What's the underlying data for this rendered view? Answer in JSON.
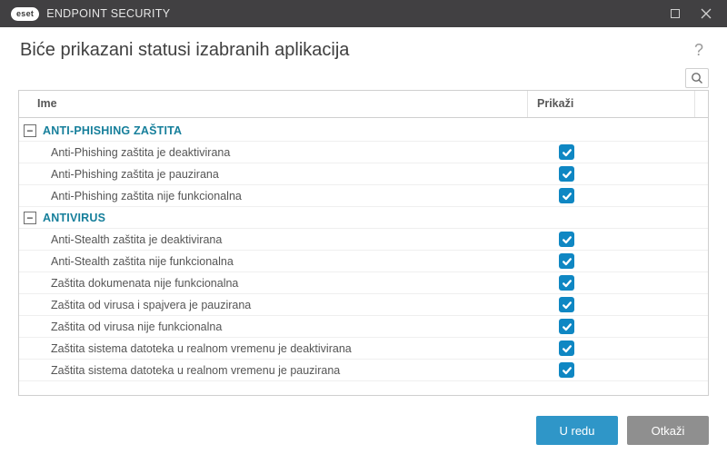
{
  "titlebar": {
    "brand_badge": "eset",
    "product": "ENDPOINT SECURITY"
  },
  "header": {
    "title": "Biće prikazani statusi izabranih aplikacija",
    "help_symbol": "?"
  },
  "columns": {
    "name": "Ime",
    "show": "Prikaži"
  },
  "toggle_glyph": "−",
  "groups": [
    {
      "label": "ANTI-PHISHING ZAŠTITA",
      "items": [
        {
          "name": "Anti-Phishing zaštita je deaktivirana",
          "checked": true
        },
        {
          "name": "Anti-Phishing zaštita je pauzirana",
          "checked": true
        },
        {
          "name": "Anti-Phishing zaštita nije funkcionalna",
          "checked": true
        }
      ]
    },
    {
      "label": "ANTIVIRUS",
      "items": [
        {
          "name": "Anti-Stealth zaštita je deaktivirana",
          "checked": true
        },
        {
          "name": "Anti-Stealth zaštita nije funkcionalna",
          "checked": true
        },
        {
          "name": "Zaštita dokumenata nije funkcionalna",
          "checked": true
        },
        {
          "name": "Zaštita od virusa i spajvera je pauzirana",
          "checked": true
        },
        {
          "name": "Zaštita od virusa nije funkcionalna",
          "checked": true
        },
        {
          "name": "Zaštita sistema datoteka u realnom vremenu je deaktivirana",
          "checked": true
        },
        {
          "name": "Zaštita sistema datoteka u realnom vremenu je pauzirana",
          "checked": true
        }
      ]
    }
  ],
  "buttons": {
    "ok": "U redu",
    "cancel": "Otkaži"
  }
}
